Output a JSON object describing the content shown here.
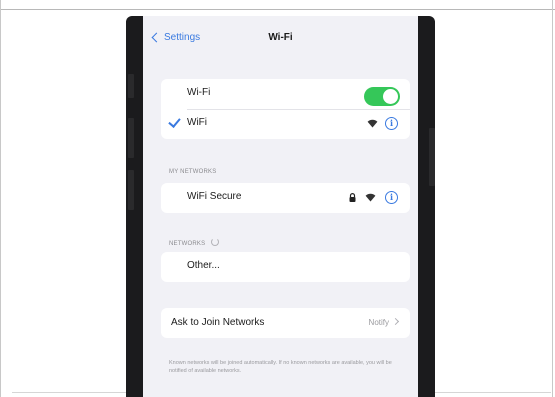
{
  "nav": {
    "back_label": "Settings",
    "title": "Wi-Fi"
  },
  "wifi_toggle": {
    "label": "Wi-Fi",
    "on": true,
    "color": "#35c759"
  },
  "connected_network": {
    "name": "WiFi"
  },
  "my_networks": {
    "header": "MY NETWORKS",
    "items": [
      {
        "name": "WiFi Secure"
      }
    ]
  },
  "networks": {
    "header": "NETWORKS",
    "other_label": "Other..."
  },
  "ask_to_join": {
    "label": "Ask to Join Networks",
    "value": "Notify",
    "description": "Known networks will be joined automatically. If no known networks are available, you will be notified of available networks."
  },
  "icons": {
    "back": "chevron-left-icon",
    "check": "checkmark-icon",
    "wifi": "wifi-signal-icon",
    "lock": "lock-icon",
    "info": "info-icon",
    "spinner": "loading-spinner-icon",
    "chevron": "chevron-right-icon"
  },
  "colors": {
    "accent": "#3a7ae0",
    "background": "#f1f1f6",
    "card": "#ffffff",
    "toggle_on": "#35c759",
    "secondary_text": "#8a8a8e"
  }
}
